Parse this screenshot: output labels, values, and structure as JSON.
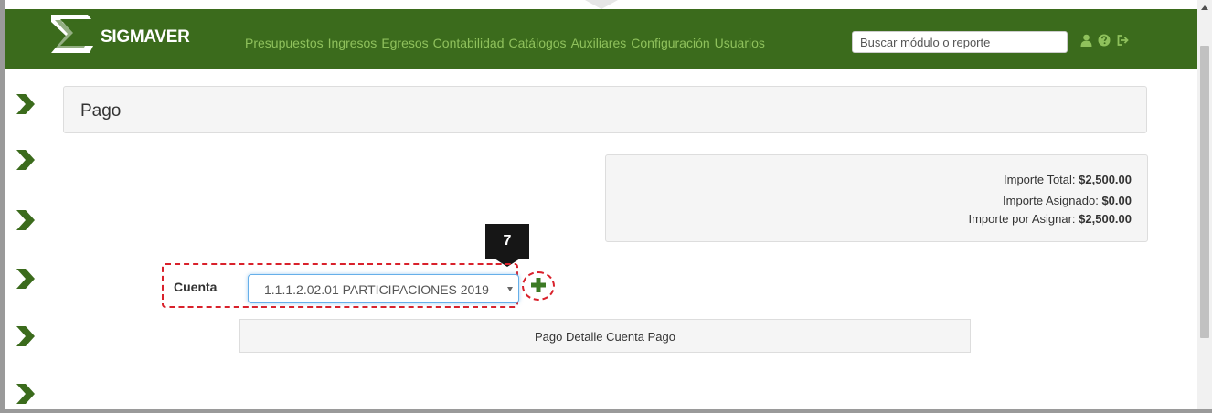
{
  "app": {
    "brand": "SIGMAVER",
    "accent_color": "#3b6b1c",
    "menu_link_color": "#8fc15c"
  },
  "nav": {
    "menu": [
      "Presupuestos",
      "Ingresos",
      "Egresos",
      "Contabilidad",
      "Catálogos",
      "Auxiliares",
      "Configuración",
      "Usuarios"
    ],
    "search_placeholder": "Buscar módulo o reporte",
    "icons": [
      "user-icon",
      "help-icon",
      "logout-icon"
    ]
  },
  "sidebar": {
    "toggle_icon": "chevron-right-icon",
    "count": 6
  },
  "page": {
    "title": "Pago"
  },
  "totals": {
    "importe_total_label": "Importe Total:",
    "importe_total_value": "$2,500.00",
    "importe_asignado_label": "Importe Asignado:",
    "importe_asignado_value": "$0.00",
    "importe_por_asignar_label": "Importe por Asignar:",
    "importe_por_asignar_value": "$2,500.00"
  },
  "callout": {
    "step": "7",
    "highlight_color": "#d9212b"
  },
  "form": {
    "cuenta_label": "Cuenta",
    "cuenta_value": "1.1.1.2.02.01 PARTICIPACIONES 2019",
    "add_icon": "plus-icon"
  },
  "detail": {
    "header": "Pago Detalle Cuenta Pago"
  }
}
